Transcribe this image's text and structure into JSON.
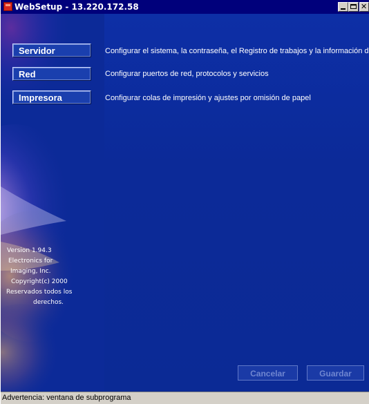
{
  "window": {
    "title": "WebSetup - 13.220.172.58"
  },
  "menu": [
    {
      "label": "Servidor",
      "description": "Configurar el sistema, la contraseña, el Registro de trabajos y la información de a"
    },
    {
      "label": "Red",
      "description": "Configurar puertos de red, protocolos y servicios"
    },
    {
      "label": "Impresora",
      "description": "Configurar colas de impresión y ajustes por omisión de papel"
    }
  ],
  "version_info": {
    "line1": "Version 1.94.3",
    "line2": "Electronics for",
    "line3": "Imaging, Inc.",
    "line4": "Copyright(c) 2000",
    "line5": "Reservados todos los",
    "line6": "derechos."
  },
  "actions": {
    "cancel_label": "Cancelar",
    "save_label": "Guardar"
  },
  "status_bar": {
    "text": "Advertencia: ventana de subprograma"
  },
  "colors": {
    "title_bar": "#00007b",
    "panel_blue": "#0c2a98",
    "status_bar": "#d4d0c8"
  }
}
